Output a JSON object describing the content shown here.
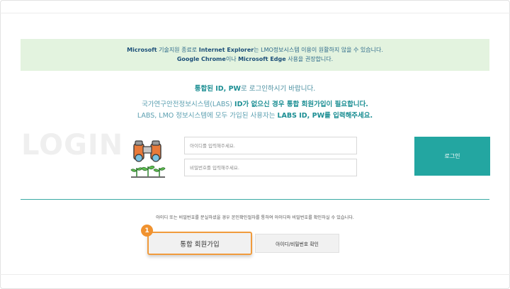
{
  "notice": {
    "line1_prefix": "Microsoft",
    "line1_a": " 기술지원 종료로 ",
    "line1_b": "Internet Explorer",
    "line1_c": "는 LMO정보시스템 이용이 원활하지 않을 수 있습니다.",
    "line2_a": "Google Chrome",
    "line2_b": "이나 ",
    "line2_c": "Microsoft Edge",
    "line2_d": " 사용을 권장합니다."
  },
  "headline": {
    "bold": "통합된 ID, PW",
    "rest": "로 로그인하시기 바랍니다."
  },
  "sub1": {
    "plain": "국가연구안전정보시스템(LABS) ",
    "bold": "ID가 없으신 경우 통합 회원가입이 필요합니다."
  },
  "sub2": {
    "plain": "LABS, LMO 정보시스템에 모두 가입된 사용자는 ",
    "bold": "LABS ID, PW를 입력해주세요."
  },
  "login_watermark": "LOGIN",
  "form": {
    "id_placeholder": "아이디를 입력해주세요.",
    "pw_placeholder": "비밀번호를 입력해주세요.",
    "login_label": "로그인"
  },
  "help_text": "아이디 또는 비밀번호를 분실하셨을 경우 본인확인절차를 통하여 아이디와 비밀번호를 확인하실 수 있습니다.",
  "buttons": {
    "join_label": "통합 회원가입",
    "find_label": "아이디/비밀번호 확인"
  },
  "annotation_badge": "1",
  "colors": {
    "accent": "#23a6a1",
    "notice_bg": "#e3f3df",
    "highlight": "#f19b3c"
  },
  "icons": {
    "illustration": "binoculars-seedling-icon"
  }
}
